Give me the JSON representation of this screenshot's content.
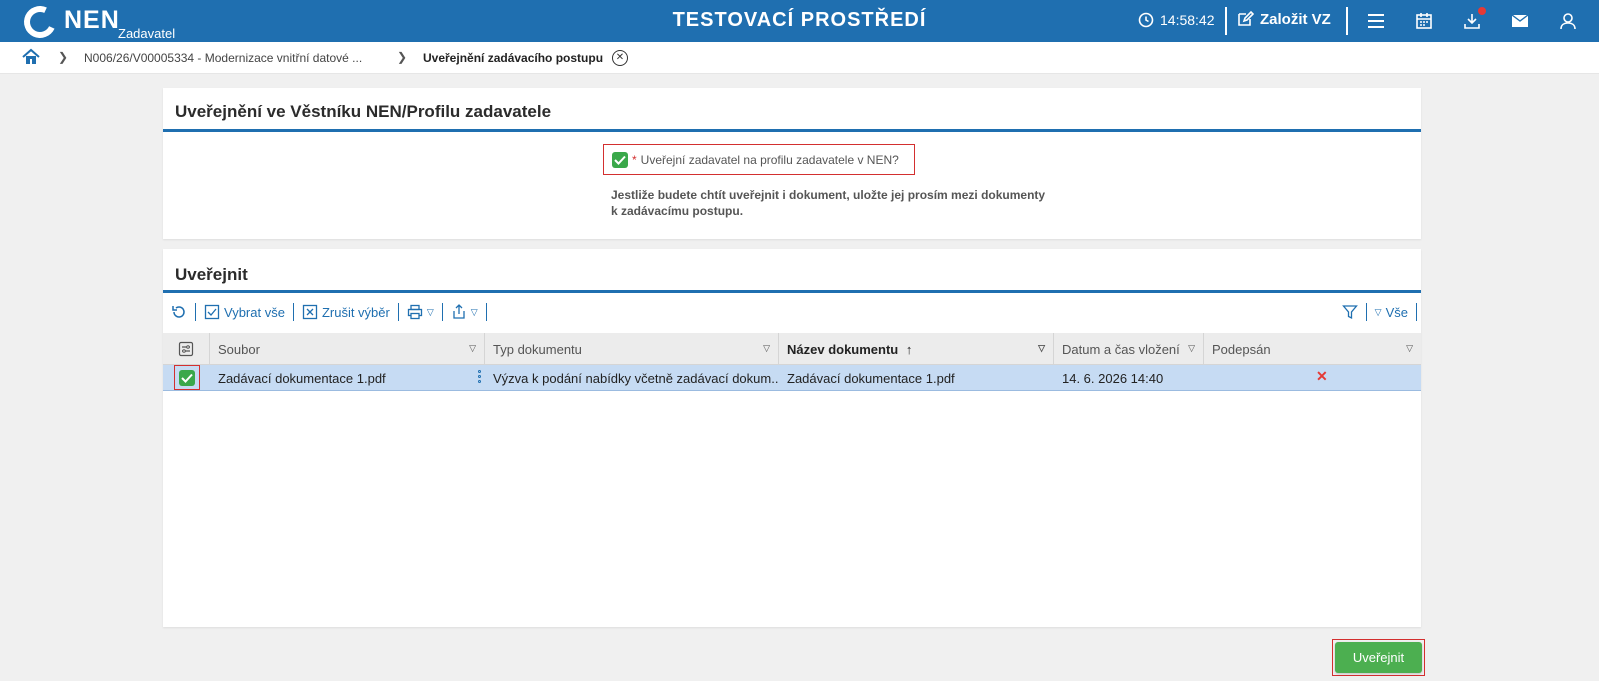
{
  "header": {
    "logo_text": "NEN",
    "logo_sub": "Zadavatel",
    "env_title": "TESTOVACÍ PROSTŘEDÍ",
    "time": "14:58:42",
    "create_label": "Založit VZ"
  },
  "breadcrumb": {
    "items": [
      "N006/26/V00005334 - Modernizace vnitřní datové ...",
      "Uveřejnění zadávacího postupu"
    ]
  },
  "publish_panel": {
    "title": "Uveřejnění ve Věstníku NEN/Profilu zadavatele",
    "required_mark": "*",
    "checkbox_label": "Uveřejní zadavatel na profilu zadavatele v NEN?",
    "checkbox_checked": true,
    "hint_line1": "Jestliže budete chtít uveřejnit i dokument, uložte jej prosím mezi dokumenty",
    "hint_line2": "k zadávacímu postupu."
  },
  "docs_panel": {
    "title": "Uveřejnit",
    "toolbar": {
      "select_all": "Vybrat vše",
      "deselect": "Zrušit výběr",
      "filter_all": "Vše"
    },
    "columns": [
      "Soubor",
      "Typ dokumentu",
      "Název dokumentu",
      "Datum a čas vložení",
      "Podepsán"
    ],
    "rows": [
      {
        "checked": true,
        "soubor": "Zadávací dokumentace 1.pdf",
        "typ": "Výzva k podání nabídky včetně zadávací dokum...",
        "nazev": "Zadávací dokumentace 1.pdf",
        "datum": "14. 6. 2026 14:40",
        "podepsan": "✕"
      }
    ]
  },
  "submit_label": "Uveřejnit",
  "colors": {
    "brand": "#1f6fb0",
    "check_green": "#3aa84a",
    "button_green": "#4caf50",
    "highlight_red": "#d32f2f",
    "row_selected": "#c6dbf3"
  }
}
